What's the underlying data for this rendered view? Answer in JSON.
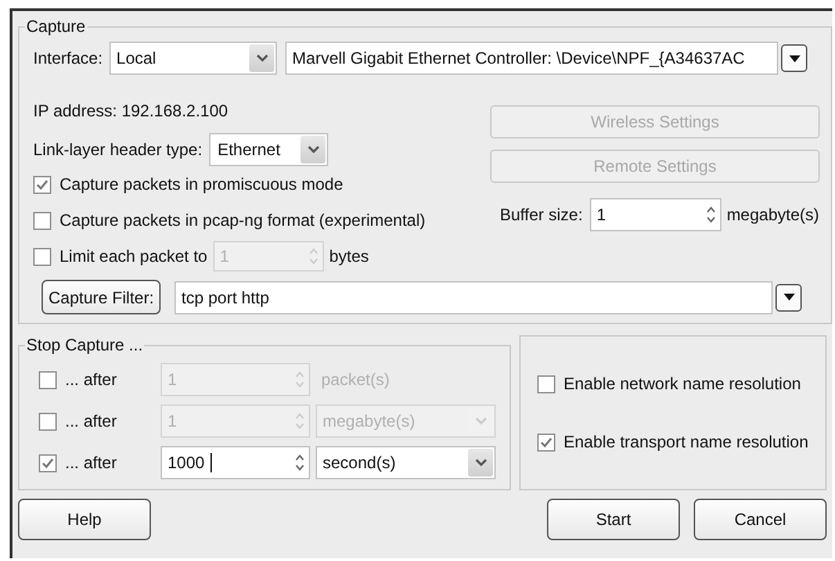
{
  "capture": {
    "title": "Capture",
    "interface": {
      "label": "Interface:",
      "source": "Local",
      "device": "Marvell Gigabit Ethernet Controller: \\Device\\NPF_{A34637AC"
    },
    "ip_address": "IP address: 192.168.2.100",
    "link_layer": {
      "label": "Link-layer header type:",
      "value": "Ethernet"
    },
    "side_buttons": [
      {
        "label": "Wireless Settings",
        "disabled": true
      },
      {
        "label": "Remote Settings",
        "disabled": true
      }
    ],
    "options": [
      {
        "label": "Capture packets in promiscuous mode",
        "checked": true
      },
      {
        "label": "Capture packets in pcap-ng format (experimental)",
        "checked": false
      }
    ],
    "limit": {
      "label": "Limit each packet to",
      "checked": false,
      "value": "1",
      "unit": "bytes"
    },
    "buffer": {
      "label": "Buffer size:",
      "value": "1",
      "unit": "megabyte(s)"
    },
    "filter": {
      "button": "Capture Filter:",
      "value": "tcp port http"
    }
  },
  "stop_capture": {
    "title": "Stop Capture ...",
    "rows": [
      {
        "kind": "text",
        "label": "... after",
        "checked": false,
        "value": "1",
        "unit": "packet(s)"
      },
      {
        "kind": "dropdown",
        "label": "... after",
        "checked": false,
        "value": "1",
        "unit": "megabyte(s)"
      },
      {
        "kind": "dropdown",
        "label": "... after",
        "checked": true,
        "value": "1000",
        "unit": "second(s)"
      }
    ]
  },
  "name_resolution": [
    {
      "label": "Enable network name resolution",
      "checked": false
    },
    {
      "label": "Enable transport name resolution",
      "checked": true
    }
  ],
  "buttons": [
    {
      "label": "Help"
    },
    {
      "label": "Start"
    },
    {
      "label": "Cancel"
    }
  ]
}
